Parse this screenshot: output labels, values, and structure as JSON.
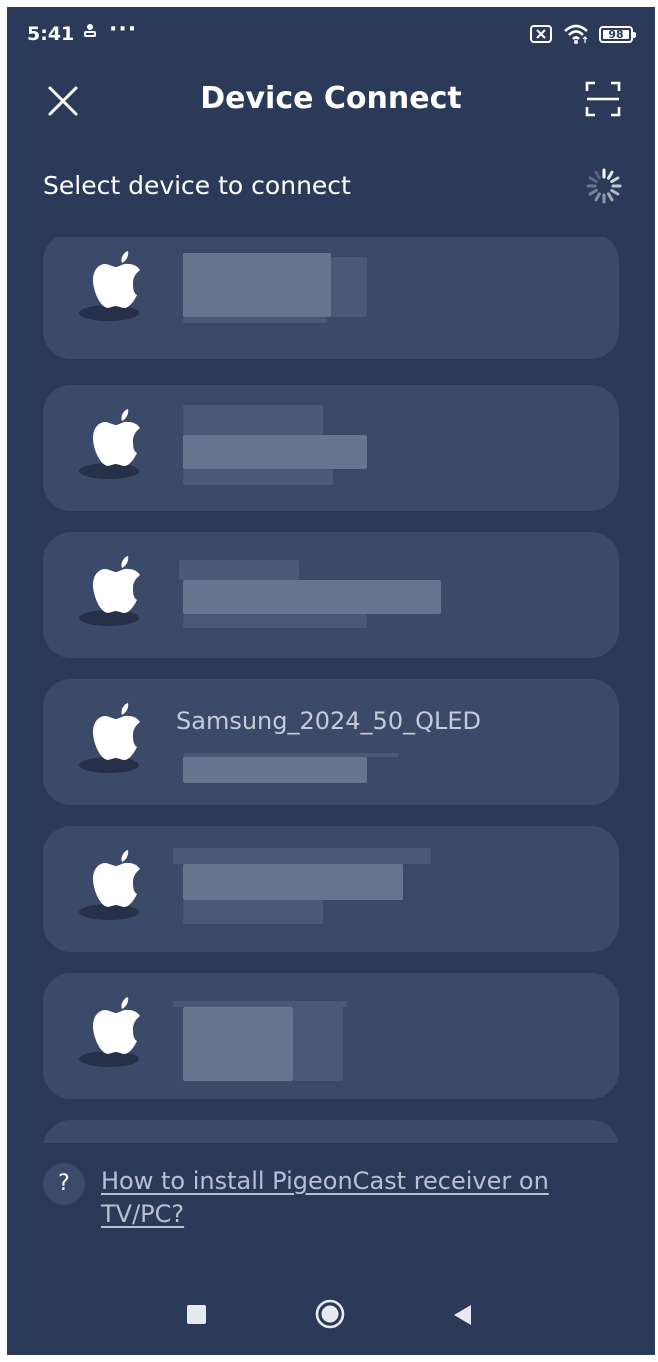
{
  "status_bar": {
    "time": "5:41",
    "dots": "···",
    "battery_level": "98"
  },
  "header": {
    "title": "Device Connect"
  },
  "section": {
    "title": "Select device to connect"
  },
  "devices": [
    {
      "name": "",
      "icon": "apple-icon"
    },
    {
      "name": "",
      "icon": "apple-icon"
    },
    {
      "name": "",
      "icon": "apple-icon"
    },
    {
      "name": "Samsung_2024_50_QLED",
      "icon": "apple-icon"
    },
    {
      "name": "",
      "icon": "apple-icon"
    },
    {
      "name": "",
      "icon": "apple-icon"
    },
    {
      "name": "",
      "icon": "apple-icon"
    }
  ],
  "help": {
    "icon_text": "?",
    "link_text": "How to install PigeonCast receiver on TV/PC?"
  },
  "colors": {
    "background": "#2c3a5a",
    "card": "#3c4a69",
    "text": "#ffffff",
    "muted_text": "#c6cbd8"
  }
}
